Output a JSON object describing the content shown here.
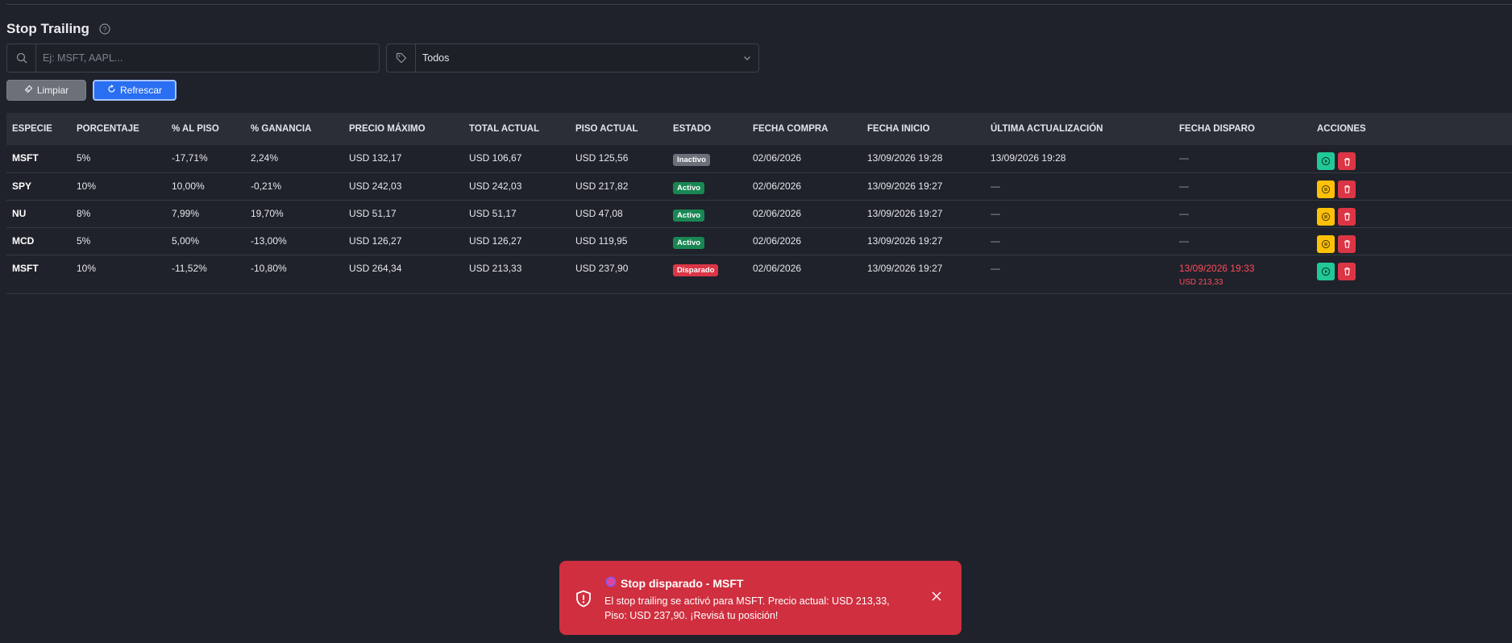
{
  "page": {
    "title": "Stop Trailing",
    "help_icon": "question-circle-icon"
  },
  "filters": {
    "search_placeholder": "Ej: MSFT, AAPL...",
    "search_value": "",
    "status_value": "Todos"
  },
  "buttons": {
    "clear_label": "Limpiar",
    "refresh_label": "Refrescar"
  },
  "table": {
    "headers": {
      "especie": "ESPECIE",
      "porcentaje": "PORCENTAJE",
      "al_piso": "% AL PISO",
      "ganancia": "% GANANCIA",
      "precio_max": "PRECIO MÁXIMO",
      "total_actual": "TOTAL ACTUAL",
      "piso_actual": "PISO ACTUAL",
      "estado": "ESTADO",
      "fecha_compra": "FECHA COMPRA",
      "fecha_inicio": "FECHA INICIO",
      "ultima_act": "ÚLTIMA ACTUALIZACIÓN",
      "fecha_disparo": "FECHA DISPARO",
      "acciones": "ACCIONES"
    },
    "rows": [
      {
        "especie": "MSFT",
        "porcentaje": "5%",
        "al_piso": "-17,71%",
        "ganancia": "2,24%",
        "precio_max": "USD 132,17",
        "total_actual": "USD 106,67",
        "piso_actual": "USD 125,56",
        "estado": "Inactivo",
        "fecha_compra": "02/06/2026",
        "fecha_inicio": "13/09/2026 19:28",
        "ultima_act": "13/09/2026 19:28",
        "fecha_disparo": "—",
        "fecha_disparo_sub": ""
      },
      {
        "especie": "SPY",
        "porcentaje": "10%",
        "al_piso": "10,00%",
        "ganancia": "-0,21%",
        "precio_max": "USD 242,03",
        "total_actual": "USD 242,03",
        "piso_actual": "USD 217,82",
        "estado": "Activo",
        "fecha_compra": "02/06/2026",
        "fecha_inicio": "13/09/2026 19:27",
        "ultima_act": "—",
        "fecha_disparo": "—",
        "fecha_disparo_sub": ""
      },
      {
        "especie": "NU",
        "porcentaje": "8%",
        "al_piso": "7,99%",
        "ganancia": "19,70%",
        "precio_max": "USD 51,17",
        "total_actual": "USD 51,17",
        "piso_actual": "USD 47,08",
        "estado": "Activo",
        "fecha_compra": "02/06/2026",
        "fecha_inicio": "13/09/2026 19:27",
        "ultima_act": "—",
        "fecha_disparo": "—",
        "fecha_disparo_sub": ""
      },
      {
        "especie": "MCD",
        "porcentaje": "5%",
        "al_piso": "5,00%",
        "ganancia": "-13,00%",
        "precio_max": "USD 126,27",
        "total_actual": "USD 126,27",
        "piso_actual": "USD 119,95",
        "estado": "Activo",
        "fecha_compra": "02/06/2026",
        "fecha_inicio": "13/09/2026 19:27",
        "ultima_act": "—",
        "fecha_disparo": "—",
        "fecha_disparo_sub": ""
      },
      {
        "especie": "MSFT",
        "porcentaje": "10%",
        "al_piso": "-11,52%",
        "ganancia": "-10,80%",
        "precio_max": "USD 264,34",
        "total_actual": "USD 213,33",
        "piso_actual": "USD 237,90",
        "estado": "Disparado",
        "fecha_compra": "02/06/2026",
        "fecha_inicio": "13/09/2026 19:27",
        "ultima_act": "—",
        "fecha_disparo": "13/09/2026 19:33",
        "fecha_disparo_sub": "USD 213,33"
      }
    ]
  },
  "toast": {
    "title": "Stop disparado - MSFT",
    "message": "El stop trailing se activó para MSFT. Precio actual: USD 213,33, Piso: USD 237,90. ¡Revisá tu posición!"
  },
  "colors": {
    "background": "#1f222a",
    "header_bg": "#2a2e37",
    "primary": "#2a6ef2",
    "active": "#198754",
    "inactive": "#6b7079",
    "fired": "#dc3545",
    "play": "#20c997",
    "pause": "#ffc107"
  }
}
